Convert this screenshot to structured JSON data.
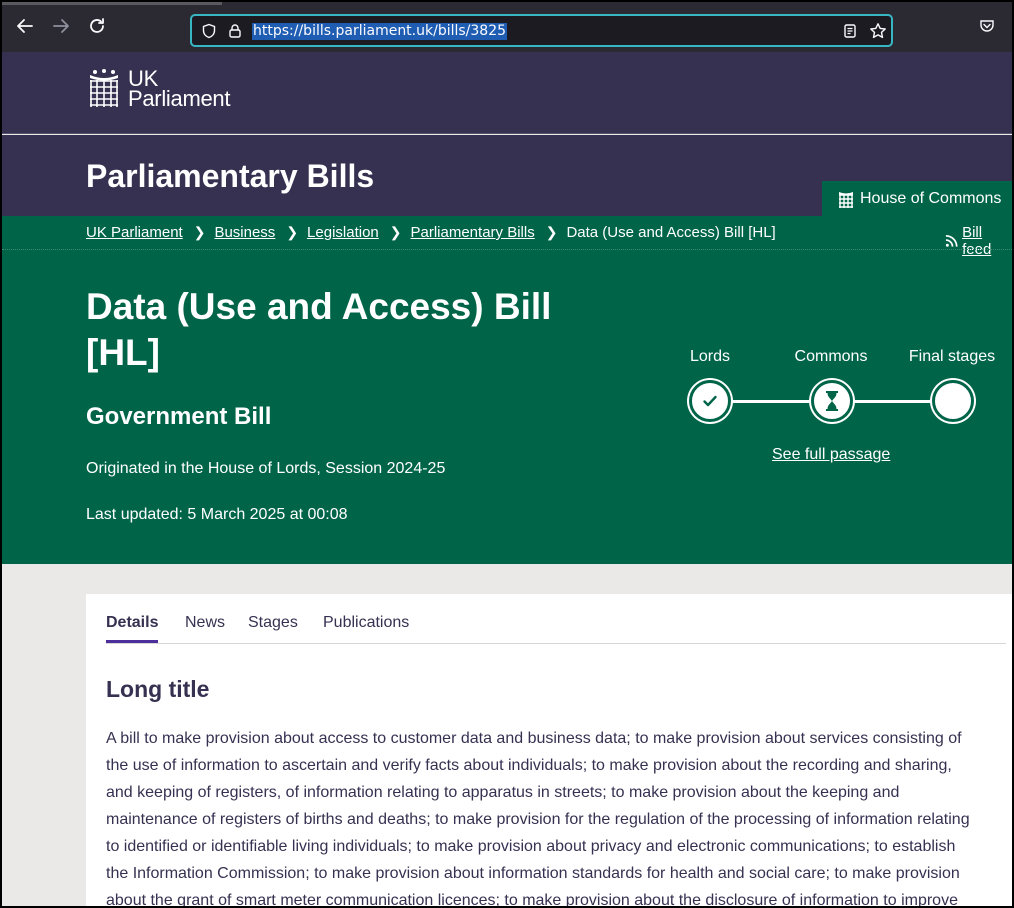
{
  "browser": {
    "url": "https://bills.parliament.uk/bills/3825",
    "icons": [
      "back-icon",
      "forward-icon",
      "reload-icon",
      "shield-icon",
      "lock-icon",
      "reader-view-icon",
      "bookmark-star-icon",
      "pocket-icon"
    ]
  },
  "header": {
    "logo_line1": "UK",
    "logo_line2": "Parliament",
    "section_title": "Parliamentary Bills",
    "house_tab": "House of Commons"
  },
  "breadcrumb": {
    "items": [
      "UK Parliament",
      "Business",
      "Legislation",
      "Parliamentary Bills"
    ],
    "current": "Data (Use and Access) Bill [HL]",
    "feed_label": "Bill feed"
  },
  "bill": {
    "title_line1": "Data (Use and Access) Bill",
    "title_line2": "[HL]",
    "type": "Government Bill",
    "originated": "Originated in the House of Lords, Session 2024-25",
    "last_updated": "Last updated: 5 March 2025 at 00:08"
  },
  "progress": {
    "stages": [
      {
        "label": "Lords",
        "status": "complete"
      },
      {
        "label": "Commons",
        "status": "in-progress"
      },
      {
        "label": "Final stages",
        "status": "pending"
      }
    ],
    "link": "See full passage"
  },
  "tabs": {
    "items": [
      "Details",
      "News",
      "Stages",
      "Publications"
    ],
    "active": "Details"
  },
  "details": {
    "heading": "Long title",
    "long_title_lines": [
      "A bill to make provision about access to customer data and business data; to make provision about services consisting of",
      "the use of information to ascertain and verify facts about individuals; to make provision about the recording and sharing,",
      "and keeping of registers, of information relating to apparatus in streets; to make provision about the keeping and",
      "maintenance of registers of births and deaths; to make provision for the regulation of the processing of information relating",
      "to identified or identifiable living individuals; to make provision about privacy and electronic communications; to establish",
      "the Information Commission; to make provision about information standards for health and social care; to make provision",
      "about the grant of smart meter communication licences; to make provision about the disclosure of information to improve"
    ]
  },
  "colors": {
    "header_purple": "#373151",
    "commons_green": "#006548",
    "tab_accent": "#4d2f9c"
  }
}
